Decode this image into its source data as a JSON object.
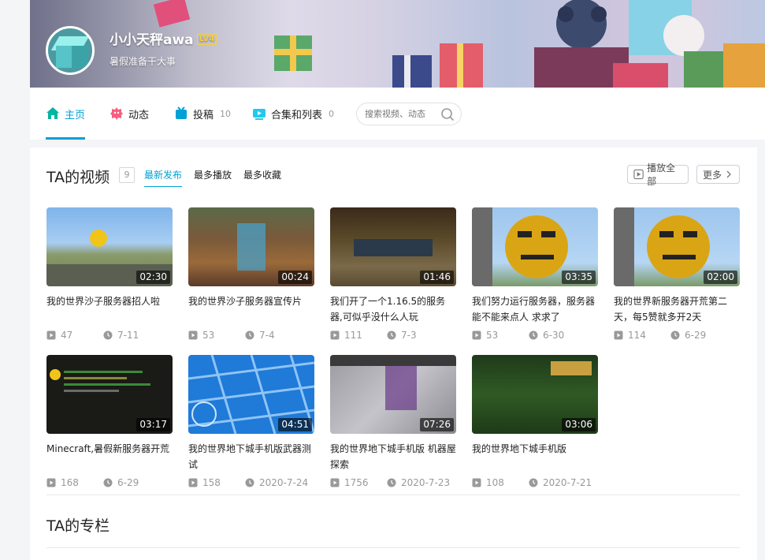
{
  "header": {
    "username": "小小天秤awa",
    "level": "LV4",
    "sign": "暑假准备干大事"
  },
  "nav": {
    "tabs": [
      {
        "label": "主页",
        "count": "",
        "icon": "home-icon",
        "active": true
      },
      {
        "label": "动态",
        "count": "",
        "icon": "feed-icon",
        "active": false
      },
      {
        "label": "投稿",
        "count": "10",
        "icon": "upload-icon",
        "active": false
      },
      {
        "label": "合集和列表",
        "count": "0",
        "icon": "collection-icon",
        "active": false
      }
    ],
    "search_placeholder": "搜索视频、动态"
  },
  "videos_section": {
    "title": "TA的视频",
    "count": "9",
    "sorts": [
      "最新发布",
      "最多播放",
      "最多收藏"
    ],
    "play_all": "播放全部",
    "more": "更多",
    "videos": [
      {
        "title": "我的世界沙子服务器招人啦",
        "duration": "02:30",
        "plays": "47",
        "date": "7-11"
      },
      {
        "title": "我的世界沙子服务器宣传片",
        "duration": "00:24",
        "plays": "53",
        "date": "7-4"
      },
      {
        "title": "我们开了一个1.16.5的服务器,可似乎没什么人玩",
        "duration": "01:46",
        "plays": "111",
        "date": "7-3"
      },
      {
        "title": "我们努力运行服务器，服务器能不能来点人 求求了",
        "duration": "03:35",
        "plays": "53",
        "date": "6-30"
      },
      {
        "title": "我的世界新服务器开荒第二天，每5赞就多开2天",
        "duration": "02:00",
        "plays": "114",
        "date": "6-29"
      },
      {
        "title": "Minecraft,暑假新服务器开荒",
        "duration": "03:17",
        "plays": "168",
        "date": "6-29"
      },
      {
        "title": "我的世界地下城手机版武器测试",
        "duration": "04:51",
        "plays": "158",
        "date": "2020-7-24"
      },
      {
        "title": "我的世界地下城手机版 机器屋探索",
        "duration": "07:26",
        "plays": "1756",
        "date": "2020-7-23"
      },
      {
        "title": "我的世界地下城手机版",
        "duration": "03:06",
        "plays": "108",
        "date": "2020-7-21"
      }
    ]
  },
  "articles_section": {
    "title": "TA的专栏"
  },
  "colors": {
    "accent": "#00a1d6",
    "text": "#222222",
    "muted": "#999999"
  }
}
